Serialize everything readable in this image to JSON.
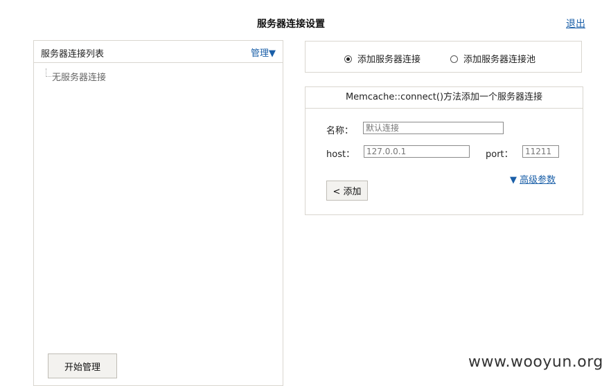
{
  "page": {
    "title": "服务器连接设置",
    "logout_label": "退出"
  },
  "left_panel": {
    "title": "服务器连接列表",
    "manage_label": "管理▼",
    "tree_items": [
      "无服务器连接"
    ],
    "start_button_label": "开始管理"
  },
  "radio_options": {
    "add_connection": {
      "label": "添加服务器连接",
      "checked": true
    },
    "add_pool": {
      "label": "添加服务器连接池",
      "checked": false
    }
  },
  "form": {
    "header": "Memcache::connect()方法添加一个服务器连接",
    "name_label": "名称：",
    "name_placeholder": "默认连接",
    "host_label": "host：",
    "host_placeholder": "127.0.0.1",
    "port_label": "port：",
    "port_placeholder": "11211",
    "advanced_arrow": "▼",
    "advanced_label": "高级参数",
    "add_button_label": "< 添加"
  },
  "watermark": "www.wooyun.org"
}
